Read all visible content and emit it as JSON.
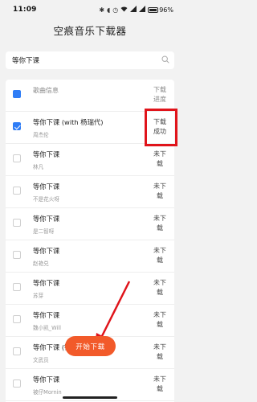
{
  "status_bar": {
    "time": "11:09",
    "icons": [
      "bluetooth-icon",
      "mute-icon",
      "alarm-icon",
      "wifi-icon",
      "signal-icon",
      "signal-icon"
    ],
    "battery": "96%"
  },
  "app": {
    "title": "空痕音乐下载器"
  },
  "search": {
    "value": "等你下课"
  },
  "list": {
    "header": {
      "title": "歌曲信息",
      "status": "下载进度"
    },
    "rows": [
      {
        "title": "等你下课 (with 杨瑞代)",
        "artist": "周杰伦",
        "status": "下载成功",
        "checked": true
      },
      {
        "title": "等你下课",
        "artist": "林凡",
        "status": "未下载",
        "checked": false
      },
      {
        "title": "等你下课",
        "artist": "不是花火呀",
        "status": "未下载",
        "checked": false
      },
      {
        "title": "等你下课",
        "artist": "是二智呀",
        "status": "未下载",
        "checked": false
      },
      {
        "title": "等你下课",
        "artist": "赵艳兑",
        "status": "未下载",
        "checked": false
      },
      {
        "title": "等你下课",
        "artist": "苏芽",
        "status": "未下载",
        "checked": false
      },
      {
        "title": "等你下课",
        "artist": "魏小凯_Will",
        "status": "未下载",
        "checked": false
      },
      {
        "title": "等你下课 (钢琴版)",
        "artist": "文武员",
        "status": "未下载",
        "checked": false
      },
      {
        "title": "等你下课",
        "artist": "被仔Mornin",
        "status": "未下载",
        "checked": false
      }
    ]
  },
  "download_button": {
    "label": "开始下载"
  },
  "colors": {
    "accent": "#f25a2a",
    "checkbox": "#2f7df6",
    "annotation": "#e0141b"
  }
}
